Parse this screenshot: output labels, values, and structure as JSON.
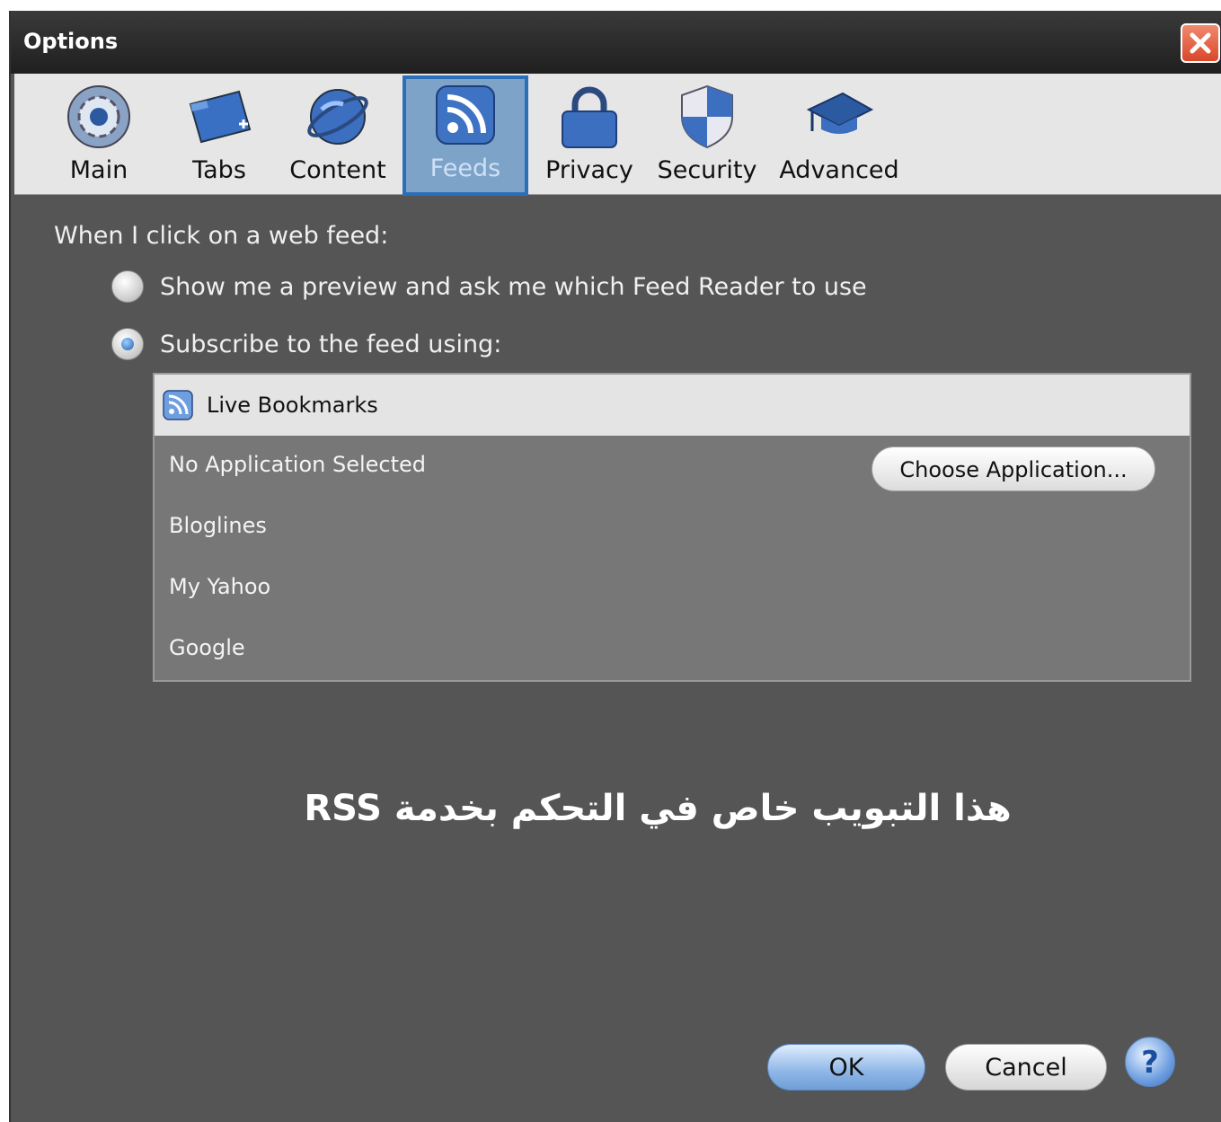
{
  "window": {
    "title": "Options"
  },
  "tabs": [
    {
      "label": "Main",
      "icon": "gear-icon"
    },
    {
      "label": "Tabs",
      "icon": "folder-tabs-icon"
    },
    {
      "label": "Content",
      "icon": "globe-icon"
    },
    {
      "label": "Feeds",
      "icon": "rss-feed-icon"
    },
    {
      "label": "Privacy",
      "icon": "lock-icon"
    },
    {
      "label": "Security",
      "icon": "shield-icon"
    },
    {
      "label": "Advanced",
      "icon": "graduation-cap-icon"
    }
  ],
  "selected_tab": "Feeds",
  "feeds": {
    "prompt": "When I click on a web feed:",
    "option_preview": "Show me a preview and ask me which Feed Reader to use",
    "option_subscribe": "Subscribe to the feed using:",
    "list_header": "Live Bookmarks",
    "list_items": [
      "No Application Selected",
      "Bloglines",
      "My Yahoo",
      "Google"
    ],
    "choose_application": "Choose Application..."
  },
  "caption": "هذا التبويب خاص في التحكم بخدمة RSS",
  "buttons": {
    "ok": "OK",
    "cancel": "Cancel",
    "help": "?"
  },
  "colors": {
    "accent": "#2a6fb8",
    "panel": "#555555"
  }
}
